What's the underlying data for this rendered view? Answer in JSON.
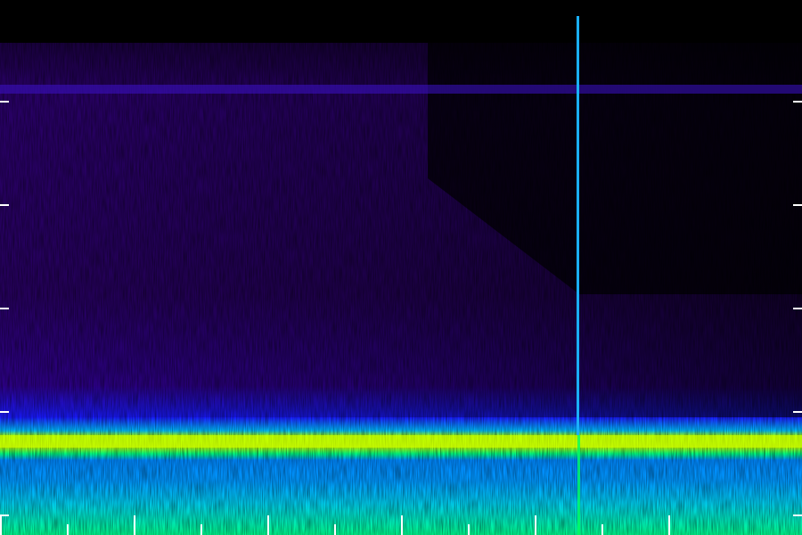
{
  "spectrogram": {
    "colormap": [
      "#000000",
      "#2a0060",
      "#4b00a0",
      "#1a1aff",
      "#0077ff",
      "#00d0ff",
      "#00ff80",
      "#a8ff00",
      "#ffff00"
    ],
    "background": "#000000",
    "tick_color": "#ffffff",
    "left_ticks": 5,
    "right_ticks": 5,
    "bottom_ticks": 11
  }
}
